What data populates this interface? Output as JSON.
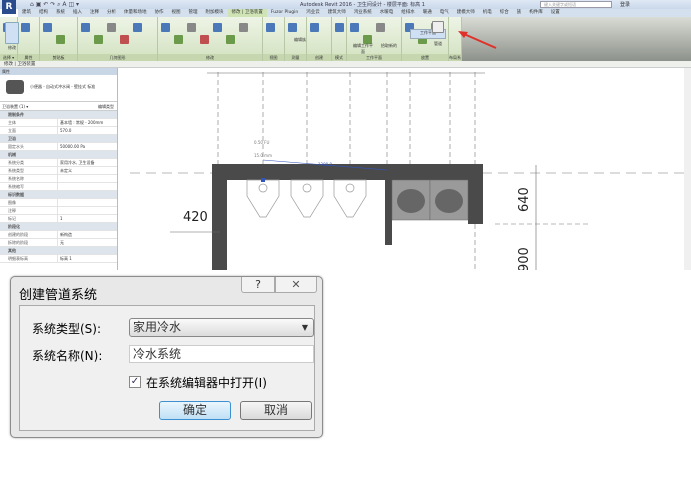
{
  "app": {
    "logo": "R",
    "title": "Autodesk Revit 2016 -   卫生间设计 - 楼层平面: 标高 1",
    "search_placeholder": "键入关键字或短语",
    "user": "登录",
    "qat": "⌂ ▣ ↶ ↷ ⌕ A ◫ ▾"
  },
  "tabs": [
    "建筑",
    "结构",
    "系统",
    "插入",
    "注释",
    "分析",
    "体量和场地",
    "协作",
    "视图",
    "管理",
    "附加模块",
    "修改 | 卫浴装置",
    "Fuzor Plugin",
    "鸿业云",
    "建筑大师",
    "鸿业系统",
    "水暖电",
    "给排水",
    "暖通",
    "电气",
    "建模大师",
    "机电",
    "综合",
    "族",
    "构件库",
    "设置"
  ],
  "active_tab": "修改 | 卫浴装置",
  "panels": [
    {
      "label": "选择 ▾"
    },
    {
      "label": "属性"
    },
    {
      "label": "剪贴板"
    },
    {
      "label": "几何图形"
    },
    {
      "label": "修改"
    },
    {
      "label": "视图"
    },
    {
      "label": "测量"
    },
    {
      "label": "创建"
    },
    {
      "label": "模式"
    },
    {
      "label": "工作平面"
    },
    {
      "label": "放置"
    },
    {
      "label": "布局系统"
    }
  ],
  "ribbon_buttons": {
    "modify": "修改",
    "edit_family": "编辑族",
    "edit_workplane": "编辑工作平面",
    "pick_new": "拾取新的",
    "workplane": "工作平面",
    "piping": "管道"
  },
  "context_bar": "修改 | 卫浴装置",
  "properties": {
    "header": "属性",
    "type_name": "小便器 - 自动式冲水阀 - 壁挂式 标准",
    "selector": "卫浴装置 (1)",
    "edit_type": "编辑类型",
    "rows": [
      {
        "group": true,
        "k": "限制条件"
      },
      {
        "k": "主体",
        "v": "基本墙 : 常规 - 200mm"
      },
      {
        "k": "立面",
        "v": "570.0"
      },
      {
        "group": true,
        "k": "卫浴"
      },
      {
        "k": "固定水头",
        "v": "50000.00 Pa"
      },
      {
        "group": true,
        "k": "机械"
      },
      {
        "k": "系统分类",
        "v": "家用冷水, 卫生设备"
      },
      {
        "k": "系统类型",
        "v": "未定义"
      },
      {
        "k": "系统名称",
        "v": ""
      },
      {
        "k": "系统缩写",
        "v": ""
      },
      {
        "group": true,
        "k": "标识数据"
      },
      {
        "k": "图像",
        "v": ""
      },
      {
        "k": "注释",
        "v": ""
      },
      {
        "k": "标记",
        "v": "1"
      },
      {
        "group": true,
        "k": "阶段化"
      },
      {
        "k": "创建的阶段",
        "v": "新构造"
      },
      {
        "k": "拆除的阶段",
        "v": "无"
      },
      {
        "group": true,
        "k": "其他"
      },
      {
        "k": "明细表标高",
        "v": "标高 1"
      }
    ]
  },
  "drawing": {
    "dim_left": "420",
    "dim_right_top": "640",
    "dim_right_bottom": "900",
    "dim_blue": "1200.0",
    "tag_text": "0.50 FU",
    "tag_text2": "15.0 mm"
  },
  "dialog": {
    "title": "创建管道系统",
    "help": "?",
    "close": "✕",
    "system_type_label": "系统类型(S):",
    "system_type_value": "家用冷水",
    "system_name_label": "系统名称(N):",
    "system_name_value": "冷水系统",
    "open_in_editor_label": "在系统编辑器中打开(I)",
    "open_in_editor_checked": true,
    "ok": "确定",
    "cancel": "取消"
  }
}
